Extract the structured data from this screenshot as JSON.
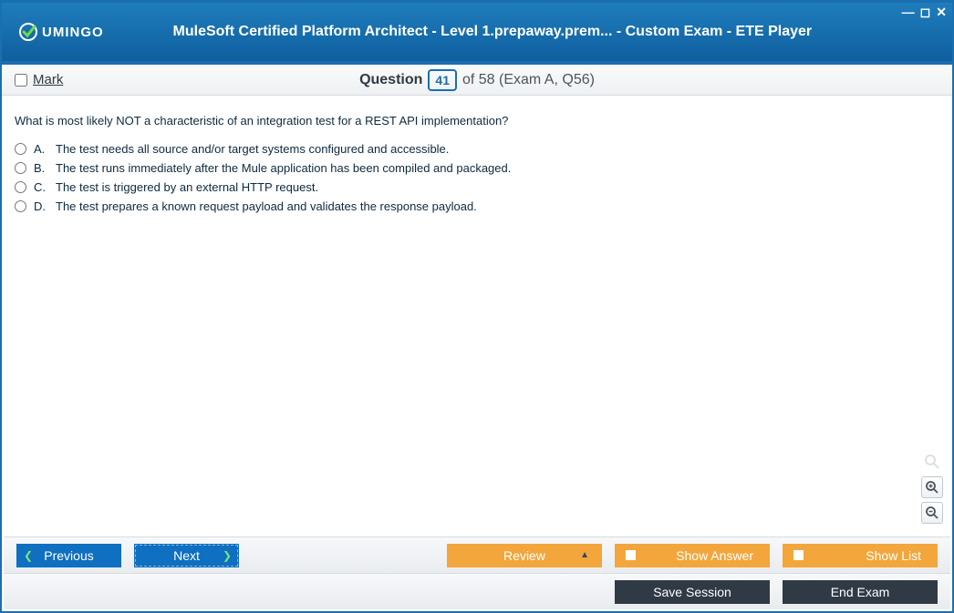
{
  "window": {
    "logo_text": "UMINGO",
    "title": "MuleSoft Certified Platform Architect - Level 1.prepaway.prem... - Custom Exam - ETE Player"
  },
  "questionbar": {
    "mark_label": "Mark",
    "question_word": "Question",
    "current": "41",
    "of_text": "of 58 (Exam A, Q56)"
  },
  "question": {
    "text": "What is most likely NOT a characteristic of an integration test for a REST API implementation?",
    "options": [
      {
        "letter": "A.",
        "text": "The test needs all source and/or target systems configured and accessible."
      },
      {
        "letter": "B.",
        "text": "The test runs immediately after the Mule application has been compiled and packaged."
      },
      {
        "letter": "C.",
        "text": "The test is triggered by an external HTTP request."
      },
      {
        "letter": "D.",
        "text": "The test prepares a known request payload and validates the response payload."
      }
    ]
  },
  "footer": {
    "previous": "Previous",
    "next": "Next",
    "review": "Review",
    "show_answer": "Show Answer",
    "show_list": "Show List",
    "save_session": "Save Session",
    "end_exam": "End Exam"
  }
}
